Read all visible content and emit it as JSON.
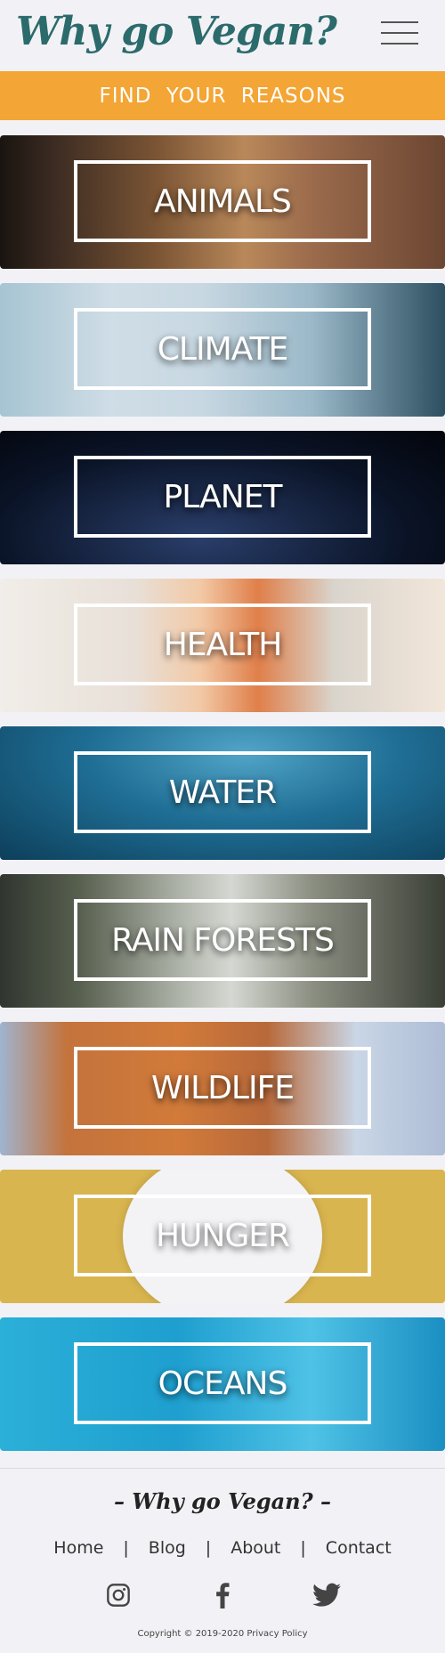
{
  "header": {
    "brand_title": "Why go Vegan?",
    "menu_icon": "hamburger-menu-icon"
  },
  "banner": {
    "text": "FIND YOUR REASONS",
    "color": "#f3a535"
  },
  "cards": [
    {
      "label": "ANIMALS"
    },
    {
      "label": "CLIMATE"
    },
    {
      "label": "PLANET"
    },
    {
      "label": "HEALTH"
    },
    {
      "label": "WATER"
    },
    {
      "label": "RAIN FORESTS"
    },
    {
      "label": "WILDLIFE"
    },
    {
      "label": "HUNGER"
    },
    {
      "label": "OCEANS"
    }
  ],
  "footer": {
    "brand_title": "– Why go Vegan? –",
    "nav": [
      "Home",
      "Blog",
      "About",
      "Contact"
    ],
    "nav_separator": "|",
    "social_icons": [
      "instagram-icon",
      "facebook-icon",
      "twitter-icon"
    ],
    "copyright": "Copyright © 2019-2020 Privacy Policy"
  },
  "colors": {
    "brand": "#2b6b6b",
    "accent": "#f3a535",
    "page_background": "#f2f2f6"
  }
}
